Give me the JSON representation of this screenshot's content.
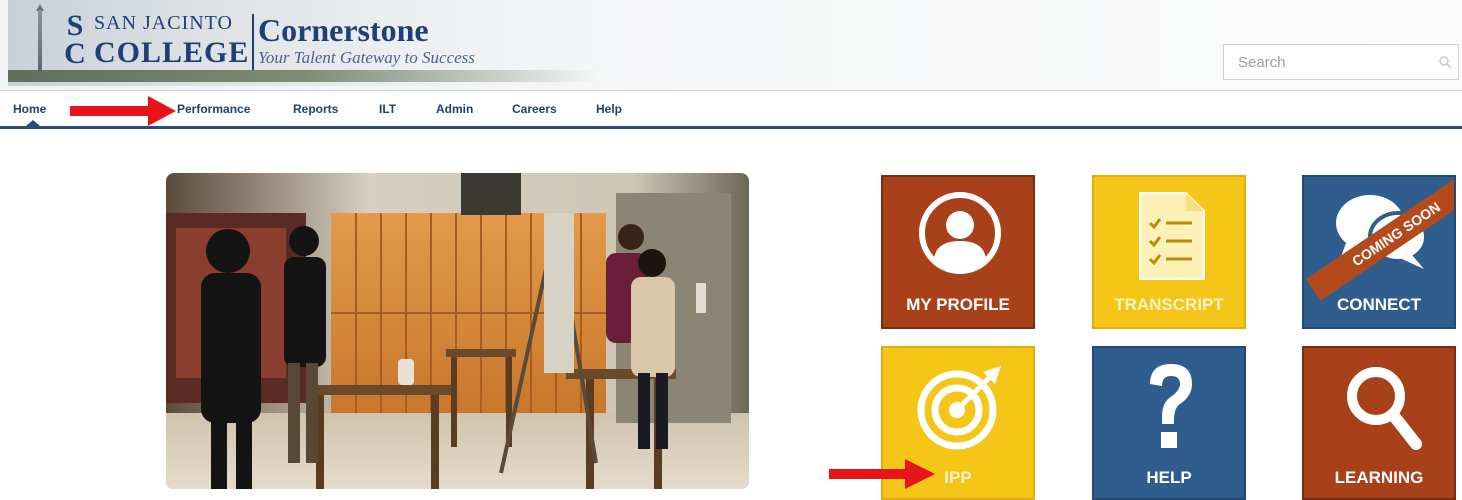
{
  "header": {
    "logo_line1": "SAN JACINTO",
    "logo_line2": "COLLEGE",
    "product_name": "Cornerstone",
    "tagline": "Your Talent Gateway to Success",
    "search_placeholder": "Search"
  },
  "nav": {
    "items": [
      {
        "label": "Home",
        "active": true
      },
      {
        "label": "Performance"
      },
      {
        "label": "Reports"
      },
      {
        "label": "ILT"
      },
      {
        "label": "Admin"
      },
      {
        "label": "Careers"
      },
      {
        "label": "Help"
      }
    ]
  },
  "tiles": [
    {
      "label": "MY PROFILE",
      "icon": "user-profile-icon",
      "color": "#a8401a"
    },
    {
      "label": "TRANSCRIPT",
      "icon": "document-checklist-icon",
      "color": "#f5c518"
    },
    {
      "label": "CONNECT",
      "icon": "chat-bubbles-icon",
      "color": "#2f5d8e",
      "ribbon": "COMING SOON"
    },
    {
      "label": "IPP",
      "icon": "target-icon",
      "color": "#f5c518"
    },
    {
      "label": "HELP",
      "icon": "question-mark-icon",
      "color": "#2f5d8e"
    },
    {
      "label": "LEARNING",
      "icon": "magnifier-icon",
      "color": "#a8401a"
    }
  ],
  "colors": {
    "brand_navy": "#1f3f78",
    "nav_rule": "#2c4a7c",
    "annotation_arrow": "#e8141b"
  }
}
